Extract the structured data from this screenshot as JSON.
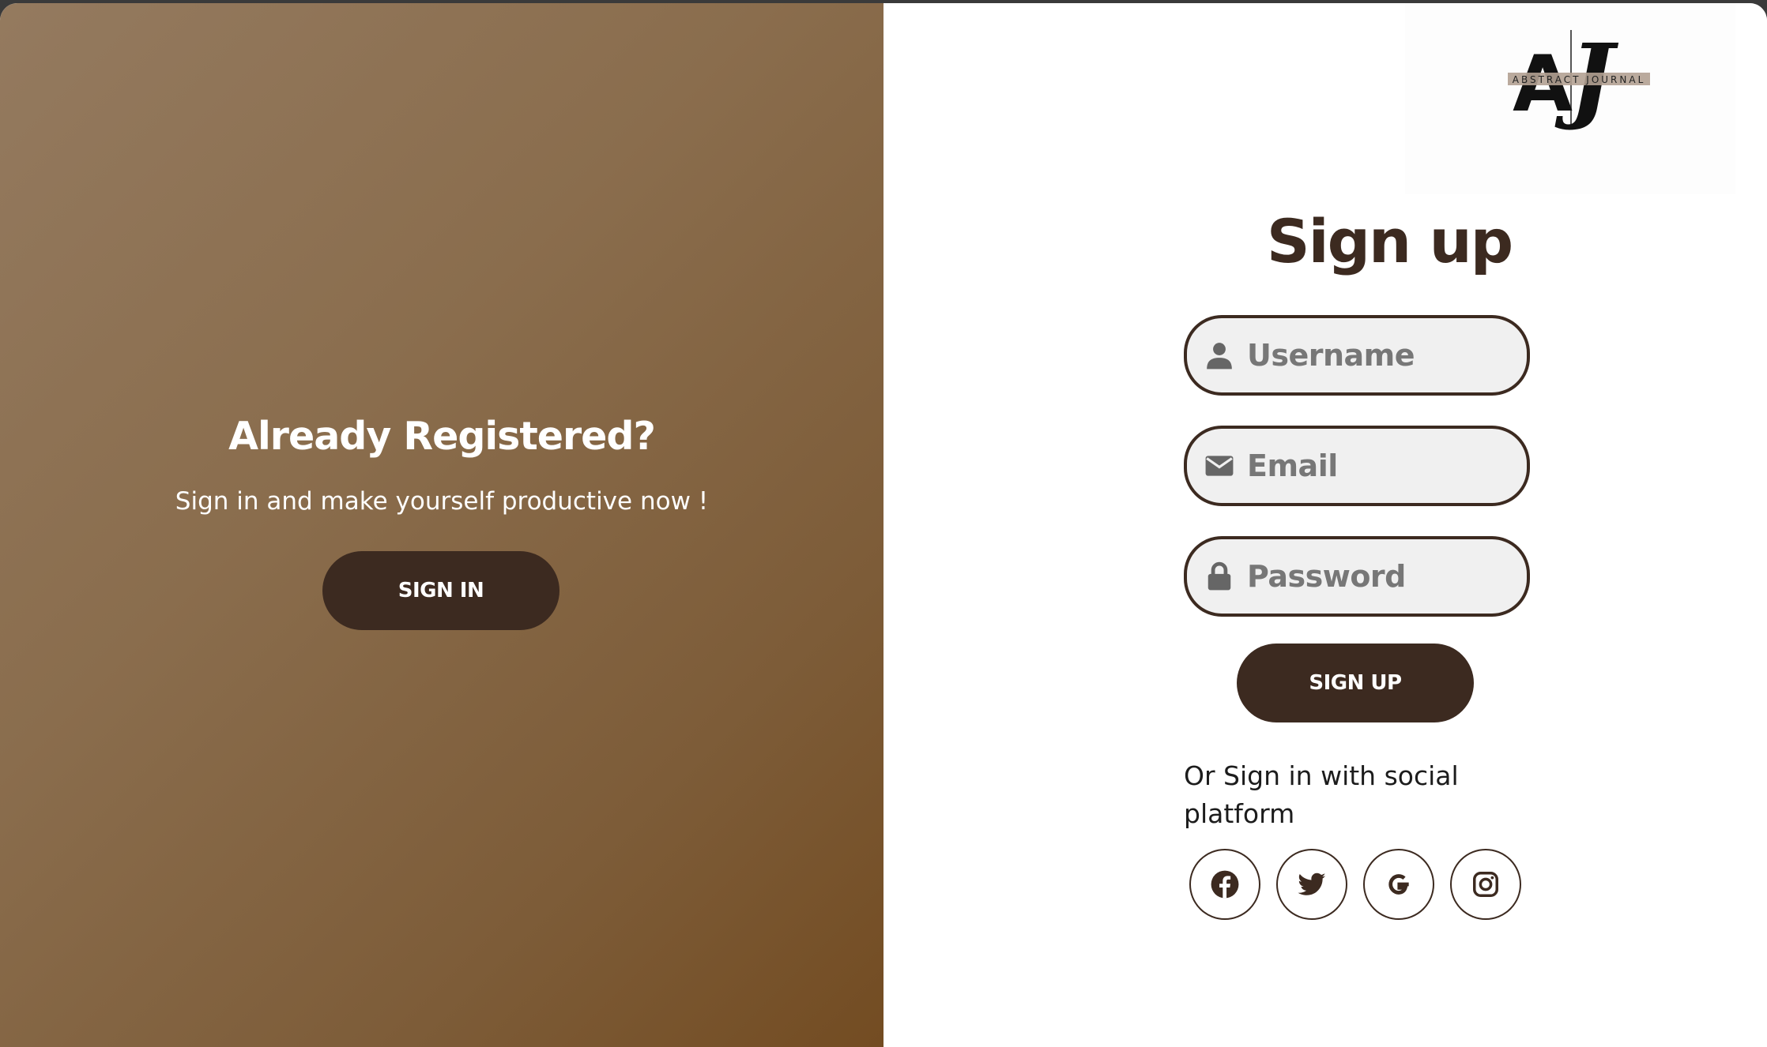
{
  "colors": {
    "accent": "#3c2a20",
    "gradient_start": "#947a5f",
    "gradient_end": "#734c22",
    "input_bg": "#f0f0f0"
  },
  "left": {
    "heading": "Already Registered?",
    "subtext": "Sign in and make yourself productive now !",
    "signin_label": "SIGN IN"
  },
  "logo": {
    "monogram": "AJ",
    "tagline": "ABSTRACT JOURNAL"
  },
  "form": {
    "title": "Sign up",
    "username": {
      "placeholder": "Username",
      "value": "",
      "icon": "user-icon"
    },
    "email": {
      "placeholder": "Email",
      "value": "",
      "icon": "envelope-icon"
    },
    "password": {
      "placeholder": "Password",
      "value": "",
      "icon": "lock-icon"
    },
    "signup_label": "SIGN UP",
    "social_text": "Or Sign in with social platform",
    "social": [
      "facebook-icon",
      "twitter-icon",
      "google-icon",
      "instagram-icon"
    ]
  }
}
